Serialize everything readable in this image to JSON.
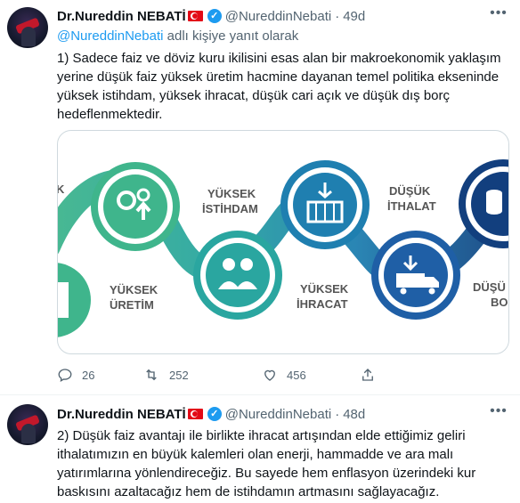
{
  "tweets": [
    {
      "author_name": "Dr.Nureddin NEBATİ",
      "handle": "@NureddinNebati",
      "separator": "·",
      "time": "49d",
      "reply_mention": "@NureddinNebati",
      "reply_suffix": " adlı kişiye yanıt olarak",
      "text": "1) Sadece faiz ve döviz kuru ikilisini esas alan bir makroekonomik yaklaşım yerine düşük faiz yüksek üretim hacmine dayanan temel politika ekseninde yüksek istihdam, yüksek ihracat, düşük cari açık ve düşük dış borç hedeflenmektedir.",
      "media": {
        "labels": {
          "k": "K",
          "yuksek_uretim": [
            "YÜKSEK",
            "ÜRETİM"
          ],
          "yuksek_istihdam": [
            "YÜKSEK",
            "İSTİHDAM"
          ],
          "yuksek_ihracat": [
            "YÜKSEK",
            "İHRACAT"
          ],
          "dusuk_ithalat": [
            "DÜŞÜK",
            "İTHALAT"
          ],
          "dusuk_bo": [
            "DÜŞÜ",
            "BO"
          ]
        },
        "colors": {
          "green": "#3fb58c",
          "teal": "#1f9aa8",
          "blue": "#1f5fa6",
          "navy": "#123f7e"
        }
      },
      "stats": {
        "replies": "26",
        "retweets": "252",
        "likes": "456"
      },
      "icons": {
        "reply": "reply-icon",
        "retweet": "retweet-icon",
        "like": "like-icon",
        "more": "more-icon"
      }
    },
    {
      "author_name": "Dr.Nureddin NEBATİ",
      "handle": "@NureddinNebati",
      "separator": "·",
      "time": "48d",
      "text": "2) Düşük faiz avantajı ile birlikte ihracat artışından elde ettiğimiz geliri ithalatımızın en büyük kalemleri olan enerji, hammadde ve ara malı yatırımlarına yönlendireceğiz. Bu sayede hem enflasyon üzerindeki kur baskısını azaltacağız hem de istihdamın artmasını sağlayacağız."
    }
  ]
}
